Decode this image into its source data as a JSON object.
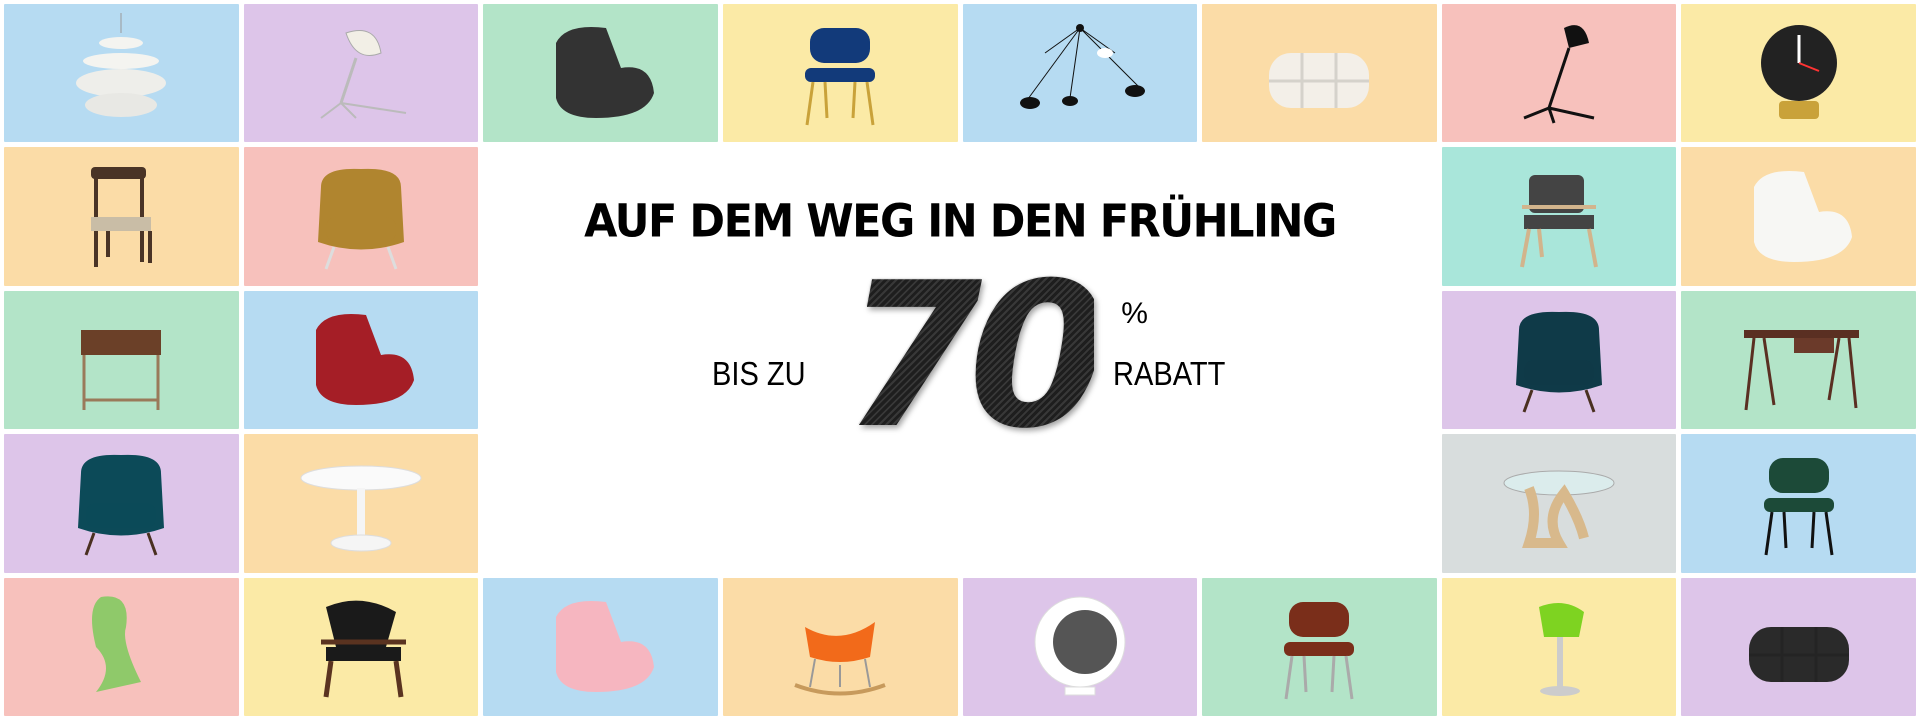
{
  "banner": {
    "title": "AUF DEM WEG IN DEN FRÜHLING",
    "prefix": "BIS ZU",
    "discount_value": "70",
    "percent_sign": "%",
    "suffix": "RABATT"
  },
  "colors": {
    "blue": "#b6dbf2",
    "lavender": "#ddc5e9",
    "green": "#b3e4c8",
    "yellow": "#fbeaa6",
    "peach": "#fbdca7",
    "pink": "#f7c1bc",
    "mint": "#a9e6da",
    "grey": "#d8dddd"
  }
}
